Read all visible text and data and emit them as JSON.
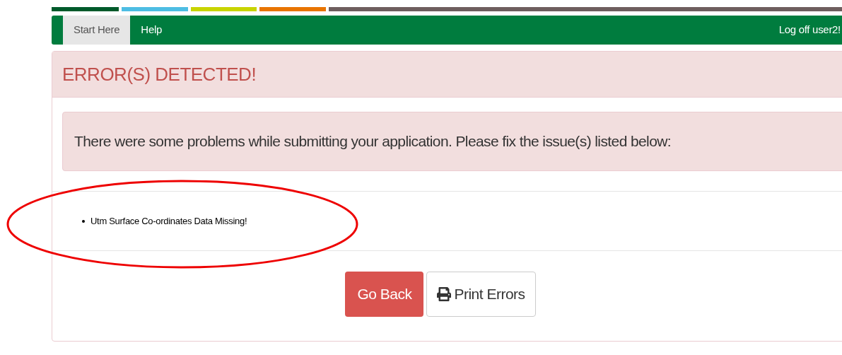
{
  "color_bars": [
    {
      "color": "#005a2b"
    },
    {
      "color": "#4dbde3"
    },
    {
      "color": "#c8d400"
    },
    {
      "color": "#e87400"
    },
    {
      "color": "#6e5e5e"
    }
  ],
  "nav": {
    "tabs": [
      {
        "label": "Start Here",
        "selected": true
      },
      {
        "label": "Help",
        "selected": false
      }
    ],
    "logoff": "Log off user2!"
  },
  "panel": {
    "title": "ERROR(S) DETECTED!",
    "alert": "There were some problems while submitting your application. Please fix the issue(s) listed below:",
    "errors": [
      "Utm Surface Co-ordinates Data Missing!"
    ],
    "buttons": [
      {
        "kind": "danger",
        "label": "Go Back"
      },
      {
        "kind": "print",
        "label": "Print Errors"
      }
    ]
  }
}
